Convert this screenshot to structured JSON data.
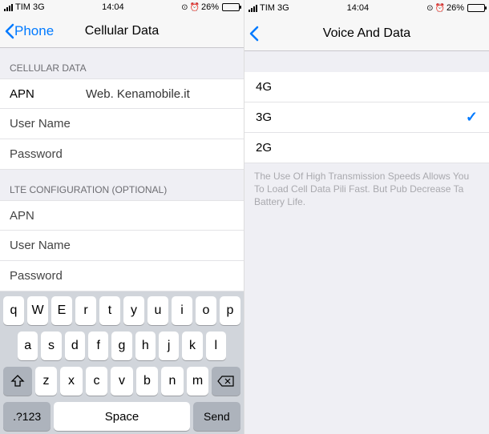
{
  "left": {
    "status": {
      "carrier": "TIM",
      "network": "3G",
      "time": "14:04",
      "battery_pct": "26%"
    },
    "nav": {
      "back_label": "Phone",
      "title": "Cellular Data"
    },
    "section1_header": "CELLULAR DATA",
    "fields1": {
      "apn_label": "APN",
      "apn_value": "Web. Kenamobile.it",
      "user_label": "User Name",
      "user_value": "",
      "pass_label": "Password",
      "pass_value": ""
    },
    "section2_header": "LTE CONFIGURATION (OPTIONAL)",
    "fields2": {
      "apn_label": "APN",
      "apn_value": "",
      "user_label": "User Name",
      "user_value": "",
      "pass_label": "Password",
      "pass_value": ""
    },
    "keyboard": {
      "row1": [
        "q",
        "W",
        "E",
        "r",
        "t",
        "y",
        "u",
        "i",
        "o",
        "p"
      ],
      "row2": [
        "a",
        "s",
        "d",
        "f",
        "g",
        "h",
        "j",
        "k",
        "l"
      ],
      "row3": [
        "z",
        "x",
        "c",
        "v",
        "b",
        "n",
        "m"
      ],
      "numkey": ".?123",
      "space": "Space",
      "send": "Send"
    }
  },
  "right": {
    "status": {
      "carrier": "TIM",
      "network": "3G",
      "time": "14:04",
      "battery_pct": "26%"
    },
    "nav": {
      "title": "Voice And Data"
    },
    "options": [
      {
        "label": "4G",
        "selected": false
      },
      {
        "label": "3G",
        "selected": true
      },
      {
        "label": "2G",
        "selected": false
      }
    ],
    "footer": "The Use Of High Transmission Speeds Allows You To Load Cell Data Pili Fast. But Pub Decrease Ta Battery Life."
  }
}
